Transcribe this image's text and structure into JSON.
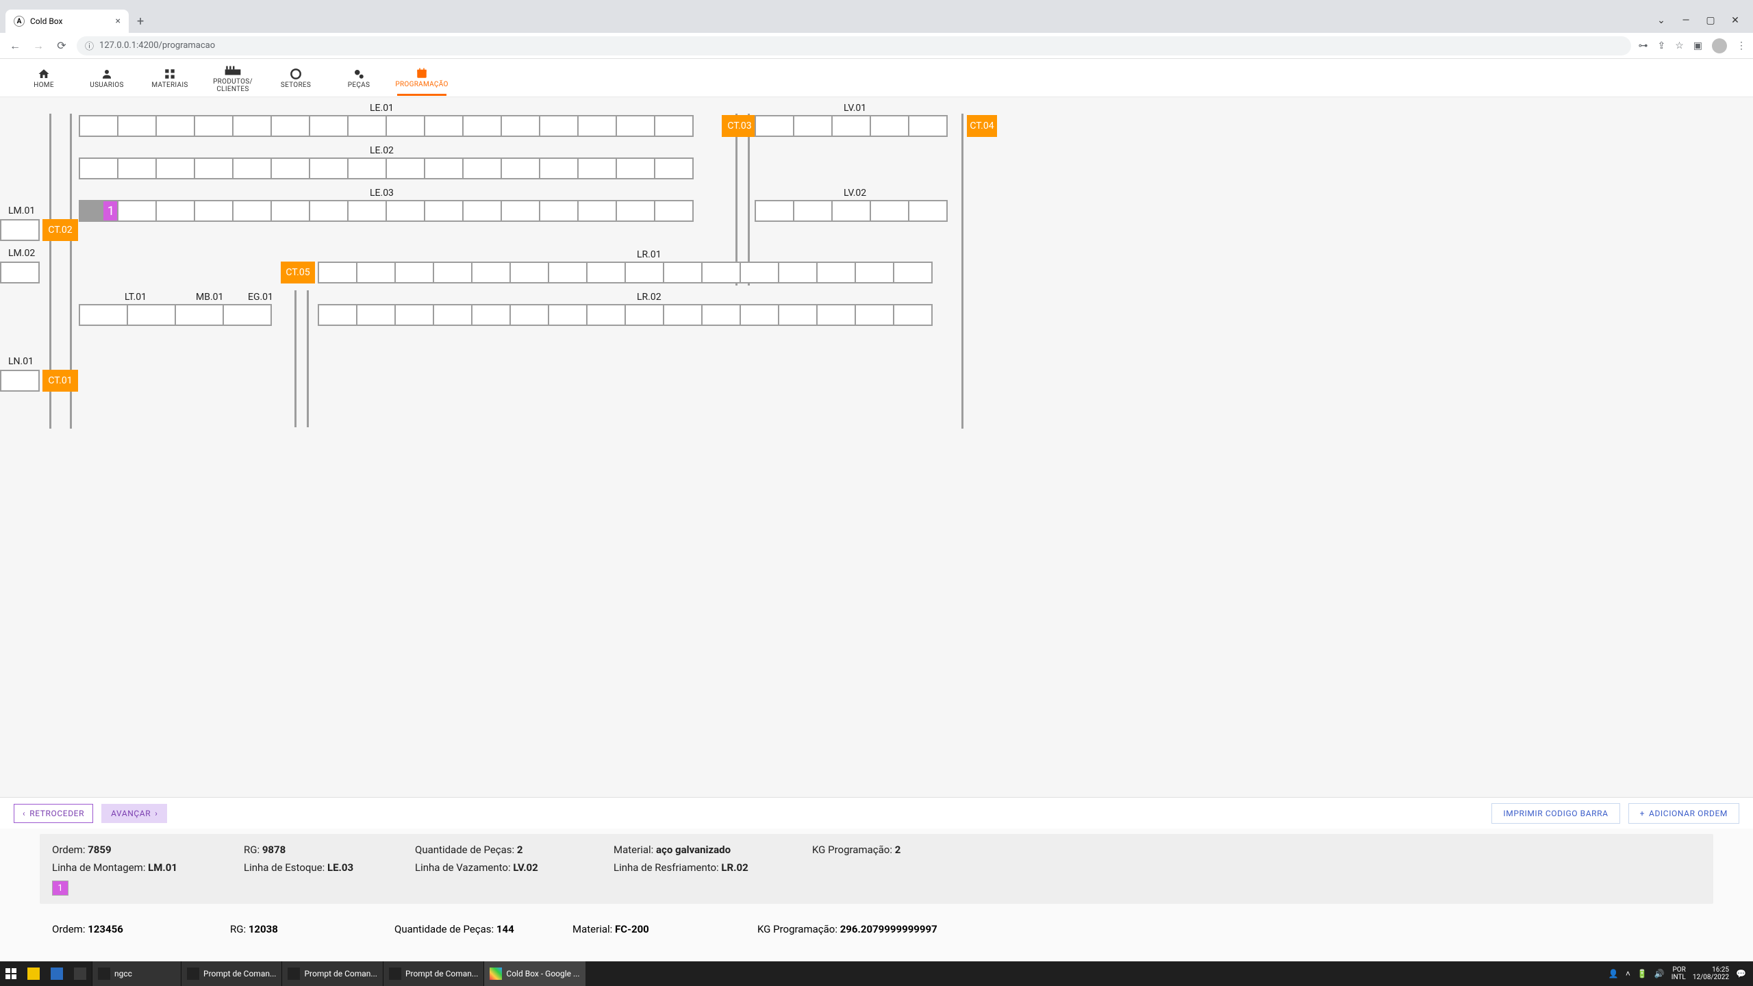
{
  "browser": {
    "tab_title": "Cold Box",
    "url": "127.0.0.1:4200/programacao"
  },
  "nav": {
    "home": "HOME",
    "usuarios": "USUARIOS",
    "materiais": "MATERIAIS",
    "produtos": "PRODUTOS/\nCLIENTES",
    "setores": "SETORES",
    "pecas": "PEÇAS",
    "programacao": "PROGRAMAÇÃO"
  },
  "labels": {
    "le01": "LE.01",
    "le02": "LE.02",
    "le03": "LE.03",
    "lv01": "LV.01",
    "lv02": "LV.02",
    "lr01": "LR.01",
    "lr02": "LR.02",
    "lm01": "LM.01",
    "lm02": "LM.02",
    "ln01": "LN.01",
    "lt01": "LT.01",
    "mb01": "MB.01",
    "eg01": "EG.01",
    "ct01": "CT.01",
    "ct02": "CT.02",
    "ct03": "CT.03",
    "ct04": "CT.04",
    "ct05": "CT.05"
  },
  "le03_fill_label": "1",
  "buttons": {
    "retroceder": "RETROCEDER",
    "avancar": "AVANÇAR",
    "imprimir": "IMPRIMIR CODIGO BARRA",
    "adicionar": "ADICIONAR ORDEM"
  },
  "order1": {
    "ordem_l": "Ordem: ",
    "ordem": "7859",
    "rg_l": "RG: ",
    "rg": "9878",
    "qtd_l": "Quantidade de Peças: ",
    "qtd": "2",
    "mat_l": "Material: ",
    "mat": "aço galvanizado",
    "kg_l": "KG Programação: ",
    "kg": "2",
    "lmont_l": "Linha de Montagem: ",
    "lmont": "LM.01",
    "lest_l": "Linha de Estoque: ",
    "lest": "LE.03",
    "lvaz_l": "Linha de Vazamento: ",
    "lvaz": "LV.02",
    "lres_l": "Linha de Resfriamento: ",
    "lres": "LR.02",
    "swatch": "1"
  },
  "order2": {
    "ordem_l": "Ordem: ",
    "ordem": "123456",
    "rg_l": "RG: ",
    "rg": "12038",
    "qtd_l": "Quantidade de Peças: ",
    "qtd": "144",
    "mat_l": "Material: ",
    "mat": "FC-200",
    "kg_l": "KG Programação: ",
    "kg": "296.2079999999997"
  },
  "taskbar": {
    "apps": [
      "ngcc",
      "Prompt de Coman...",
      "Prompt de Coman...",
      "Prompt de Coman...",
      "Cold Box - Google ..."
    ],
    "kb1": "POR",
    "kb2": "INTL",
    "time": "16:25",
    "date": "12/08/2022"
  }
}
